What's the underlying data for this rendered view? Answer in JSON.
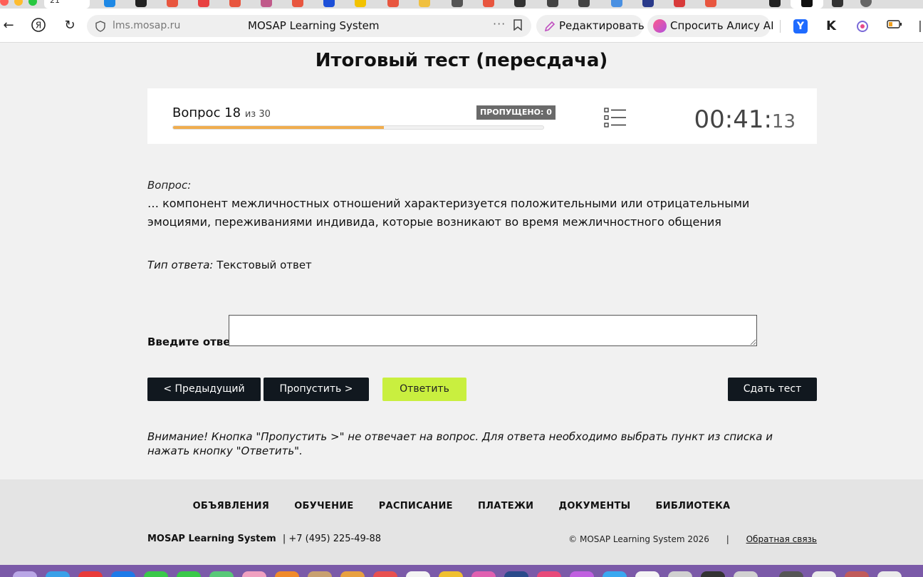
{
  "browser": {
    "url": "lms.mosap.ru",
    "page_title": "MOSAP Learning System",
    "edit_label": "Редактировать",
    "alice_label": "Спросить Алису AI",
    "tab_badge": "21",
    "colors": {
      "tab_red": "#e8563f",
      "tab_blue": "#1e88e5",
      "ext_yandex_blue": "#1f6bff",
      "alice_purple": "#b050e0"
    }
  },
  "test": {
    "title": "Итоговый тест (пересдача)",
    "question_label": "Вопрос 18",
    "question_of": "из 30",
    "progress_fraction": 0.57,
    "skipped_label": "ПРОПУЩЕНО: 0",
    "timer_main": "00:41:",
    "timer_seconds": "13",
    "question_caption": "Вопрос:",
    "question_text": "… компонент межличностных отношений характеризуется положительными или отрицательными эмоциями, переживаниями индивида, которые возникают во время межличностного общения",
    "answer_type_label": "Тип ответа:",
    "answer_type_value": "Текстовый ответ",
    "answer_prompt": "Введите ответ:",
    "answer_value": "",
    "buttons": {
      "prev": "< Предыдущий",
      "skip": "Пропустить >",
      "answer": "Ответить",
      "submit": "Сдать тест"
    },
    "warning": "Внимание! Кнопка \"Пропустить >\" не отвечает на вопрос. Для ответа необходимо выбрать пункт из списка и нажать кнопку \"Ответить\".",
    "colors": {
      "progress": "#f0ad4e",
      "answer_button": "#c9ef3f",
      "dark_button": "#11181f"
    }
  },
  "footer": {
    "nav": [
      "ОБЪЯВЛЕНИЯ",
      "ОБУЧЕНИЕ",
      "РАСПИСАНИЕ",
      "ПЛАТЕЖИ",
      "ДОКУМЕНТЫ",
      "БИБЛИОТЕКА"
    ],
    "brand": "MOSAP Learning System",
    "phone": "| +7 (495) 225-49-88",
    "copyright": "© MOSAP Learning System 2026",
    "separator": "|",
    "feedback": "Обратная связь"
  }
}
